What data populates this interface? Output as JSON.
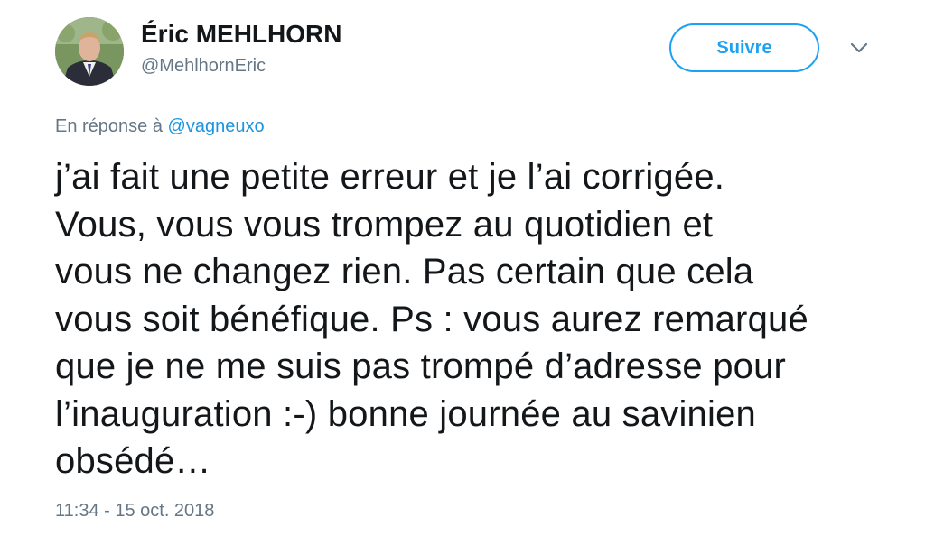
{
  "author": {
    "display_name": "Éric MEHLHORN",
    "handle": "@MehlhornEric"
  },
  "follow_button": {
    "label": "Suivre"
  },
  "reply_context": {
    "prefix": "En réponse à",
    "mention": "@vagneuxo"
  },
  "tweet": {
    "text_lines": [
      "j’ai fait une petite erreur et je l’ai corrigée.",
      "Vous, vous vous trompez au quotidien et",
      "vous ne changez rien. Pas certain que cela",
      "vous soit bénéfique. Ps : vous aurez remarqué",
      "que je ne me suis pas trompé d’adresse pour",
      "l’inauguration :-) bonne journée au savinien",
      "obsédé…"
    ],
    "timestamp": "11:34 - 15 oct. 2018"
  },
  "icons": {
    "caret": "chevron-down-icon",
    "avatar": "avatar-photo"
  },
  "colors": {
    "accent": "#1da1f2",
    "mention": "#1b95e0",
    "secondary_text": "#657786",
    "primary_text": "#14171a"
  }
}
